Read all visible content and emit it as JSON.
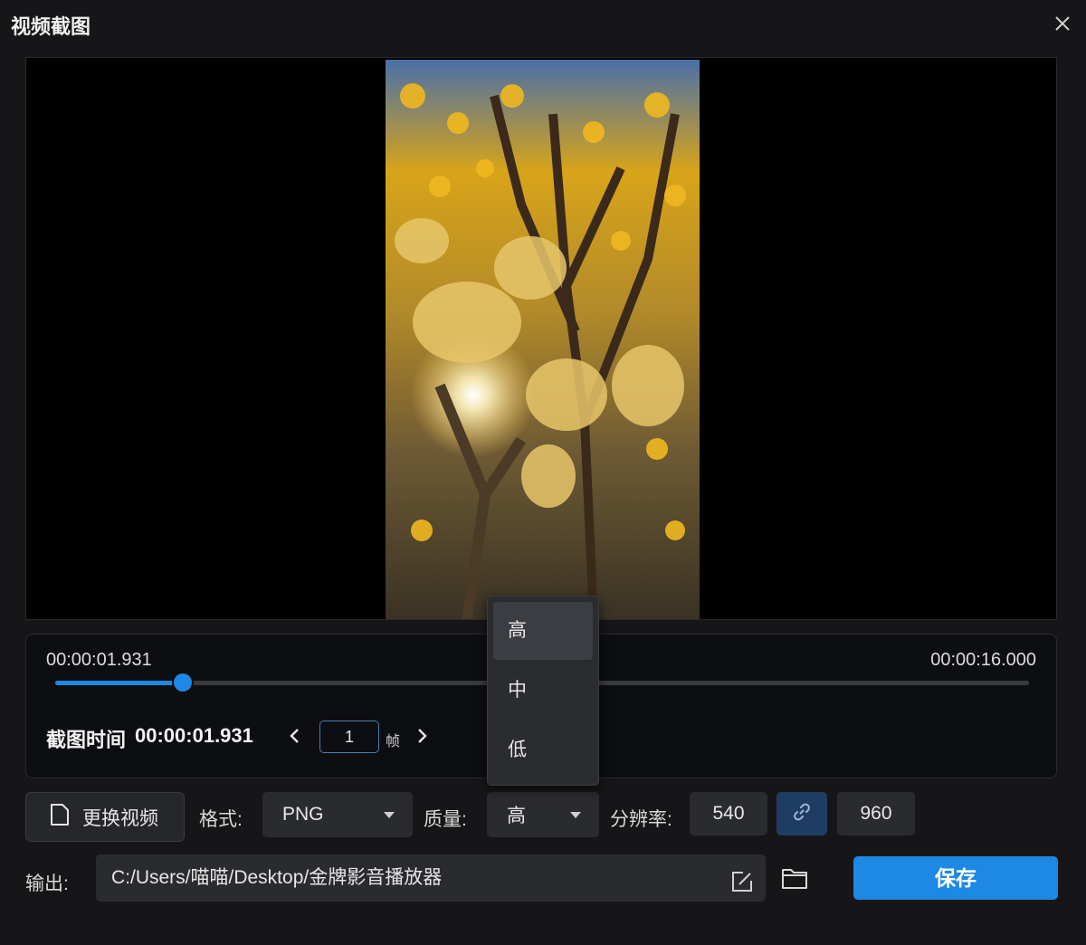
{
  "window": {
    "title": "视频截图"
  },
  "timeline": {
    "current_time": "00:00:01.931",
    "total_time": "00:00:16.000",
    "progress": 0.131
  },
  "capture": {
    "label": "截图时间",
    "time": "00:00:01.931",
    "frame_step": "1",
    "frame_unit": "帧"
  },
  "controls": {
    "change_video_label": "更换视频",
    "format_label": "格式:",
    "format_value": "PNG",
    "quality_label": "质量:",
    "quality_value": "高",
    "resolution_label": "分辨率:",
    "width": "540",
    "height": "960"
  },
  "quality_dropdown": {
    "options": [
      "高",
      "中",
      "低"
    ],
    "selected_index": 0
  },
  "output": {
    "label": "输出:",
    "path": "C:/Users/喵喵/Desktop/金牌影音播放器"
  },
  "save_label": "保存",
  "colors": {
    "accent": "#1e88e5",
    "background": "#161618",
    "control": "#2a2b2f"
  }
}
